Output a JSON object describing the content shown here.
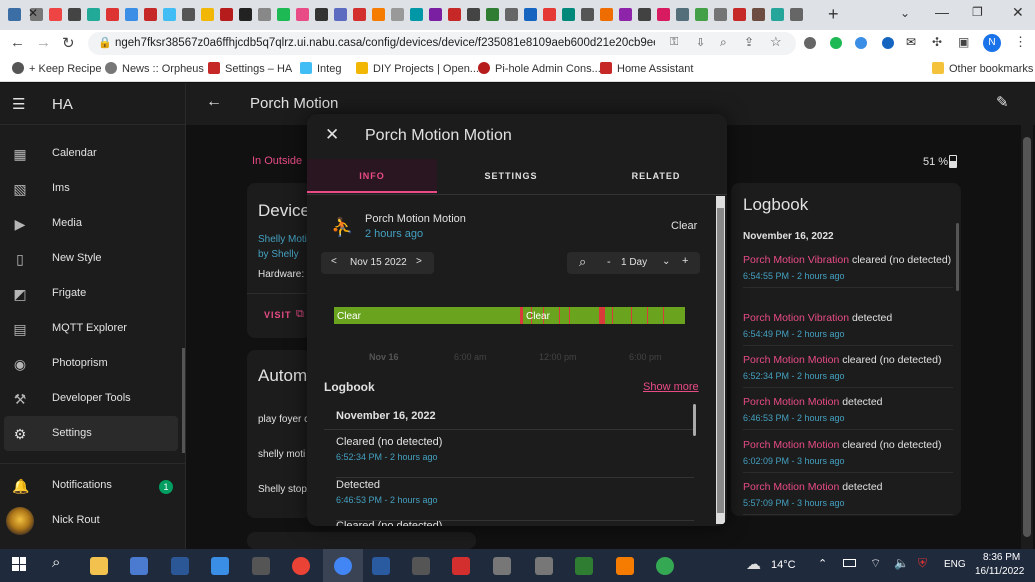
{
  "browser": {
    "url": "ngeh7fksr38567z0a6ffhjcdb5q7qlrz.ui.nabu.casa/config/devices/device/f235081e8109aeb600d21e20cb9ee...",
    "profile_initial": "N",
    "bookmarks": [
      "+ Keep Recipe",
      "News :: Orpheus",
      "Settings – HA",
      "Integ",
      "DIY Projects | Open...",
      "Pi-hole Admin Cons...",
      "Home Assistant"
    ],
    "other_bookmarks": "Other bookmarks"
  },
  "sidebar": {
    "title": "HA",
    "items": [
      {
        "label": "Calendar",
        "icon": "calendar-icon"
      },
      {
        "label": "Ims",
        "icon": "image-icon"
      },
      {
        "label": "Media",
        "icon": "media-icon"
      },
      {
        "label": "New Style",
        "icon": "style-icon"
      },
      {
        "label": "Frigate",
        "icon": "cctv-icon"
      },
      {
        "label": "MQTT Explorer",
        "icon": "mqtt-icon"
      },
      {
        "label": "Photoprism",
        "icon": "camera-icon"
      },
      {
        "label": "Developer Tools",
        "icon": "hammer-icon"
      },
      {
        "label": "Settings",
        "icon": "gear-icon"
      }
    ],
    "notifications": {
      "label": "Notifications",
      "count": "1"
    },
    "user": "Nick Rout"
  },
  "page": {
    "title": "Porch Motion",
    "area_link": "In Outside",
    "battery": "51 %",
    "device_card": {
      "title": "Device",
      "model_line1": "Shelly Moti",
      "model_line2": "by Shelly",
      "hardware_label": "Hardware:",
      "visit_label": "VISIT"
    },
    "automations_card": {
      "title": "Autom",
      "items": [
        "play foyer c",
        "shelly moti",
        "Shelly stop"
      ]
    }
  },
  "dialog": {
    "title": "Porch Motion Motion",
    "tabs": [
      "INFO",
      "SETTINGS",
      "RELATED"
    ],
    "entity_name": "Porch Motion Motion",
    "entity_time": "2 hours ago",
    "entity_state": "Clear",
    "date_label": "Nov 15 2022",
    "range_label": "1 Day",
    "timeline_labels": [
      "Clear",
      "Clear"
    ],
    "axis_ticks": [
      "Nov 16",
      "6:00 am",
      "12:00 pm",
      "6:00 pm"
    ],
    "logbook_title": "Logbook",
    "show_more": "Show more",
    "logbook_date": "November 16, 2022",
    "entries": [
      {
        "title": "Cleared (no detected)",
        "time": "6:52:34 PM",
        "ago": "2 hours ago"
      },
      {
        "title": "Detected",
        "time": "6:46:53 PM",
        "ago": "2 hours ago"
      },
      {
        "title": "Cleared (no detected)",
        "time": "",
        "ago": ""
      }
    ]
  },
  "right_logbook": {
    "title": "Logbook",
    "date": "November 16, 2022",
    "entries": [
      {
        "entity": "Porch Motion Vibration",
        "action": "cleared (no detected)",
        "time": "6:54:55 PM",
        "ago": "2 hours ago"
      },
      {
        "entity": "Porch Motion Vibration",
        "action": "detected",
        "time": "6:54:49 PM",
        "ago": "2 hours ago"
      },
      {
        "entity": "Porch Motion Motion",
        "action": "cleared (no detected)",
        "time": "6:52:34 PM",
        "ago": "2 hours ago"
      },
      {
        "entity": "Porch Motion Motion",
        "action": "detected",
        "time": "6:46:53 PM",
        "ago": "2 hours ago"
      },
      {
        "entity": "Porch Motion Motion",
        "action": "cleared (no detected)",
        "time": "6:02:09 PM",
        "ago": "3 hours ago"
      },
      {
        "entity": "Porch Motion Motion",
        "action": "detected",
        "time": "5:57:09 PM",
        "ago": "3 hours ago"
      }
    ]
  },
  "taskbar": {
    "weather": "14°C",
    "lang": "ENG",
    "time": "8:36 PM",
    "date": "16/11/2022"
  },
  "colors": {
    "accent": "#e94b86",
    "link": "#44a0c0",
    "clear": "#6aa41e",
    "detected": "#d93a3a"
  }
}
